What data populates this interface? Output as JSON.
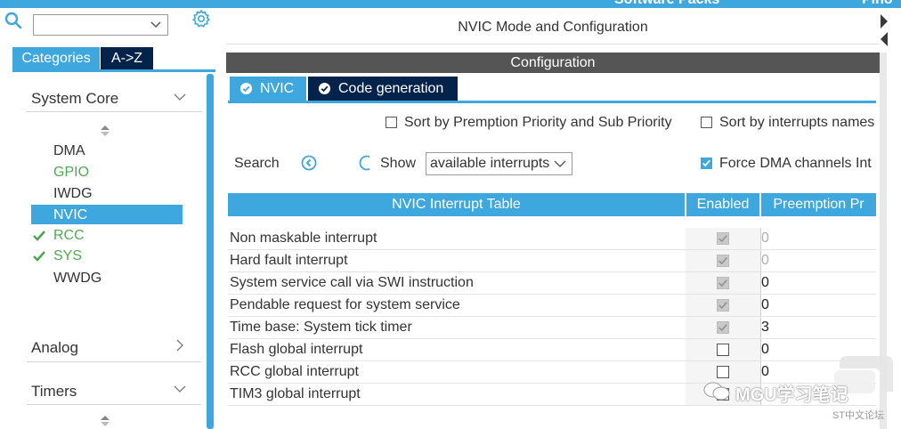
{
  "topbar": {
    "right_text": "Software Packs",
    "far_right": "Pino"
  },
  "left_panel": {
    "search": {
      "value": ""
    },
    "tabs": [
      {
        "label": "Categories"
      },
      {
        "label": "A->Z"
      }
    ],
    "groups": [
      {
        "title": "System Core",
        "expanded": true,
        "items": [
          {
            "label": "DMA",
            "status": "normal"
          },
          {
            "label": "GPIO",
            "status": "configured"
          },
          {
            "label": "IWDG",
            "status": "normal"
          },
          {
            "label": "NVIC",
            "status": "selected"
          },
          {
            "label": "RCC",
            "status": "checked"
          },
          {
            "label": "SYS",
            "status": "checked"
          },
          {
            "label": "WWDG",
            "status": "normal"
          }
        ]
      },
      {
        "title": "Analog",
        "expanded": false
      },
      {
        "title": "Timers",
        "expanded": true
      }
    ]
  },
  "main": {
    "mode_title": "NVIC Mode and Configuration",
    "config_title": "Configuration",
    "tabs": [
      {
        "label": "NVIC"
      },
      {
        "label": "Code generation"
      }
    ],
    "options": {
      "sort_priority": {
        "label": "Sort by Premption Priority and Sub Priority",
        "checked": false
      },
      "sort_names": {
        "label": "Sort by interrupts names",
        "checked": false
      },
      "force_dma": {
        "label": "Force DMA channels Int",
        "checked": true
      }
    },
    "search_label": "Search",
    "show_label": "Show",
    "show_value": "available interrupts",
    "table": {
      "headers": [
        "NVIC Interrupt Table",
        "Enabled",
        "Preemption Pr"
      ],
      "rows": [
        {
          "name": "Non maskable interrupt",
          "enabled": true,
          "locked": true,
          "preemption": "0"
        },
        {
          "name": "Hard fault interrupt",
          "enabled": true,
          "locked": true,
          "preemption": "0"
        },
        {
          "name": "System service call via SWI instruction",
          "enabled": true,
          "locked": true,
          "preemption": "0"
        },
        {
          "name": "Pendable request for system service",
          "enabled": true,
          "locked": true,
          "preemption": "0"
        },
        {
          "name": "Time base: System tick timer",
          "enabled": true,
          "locked": true,
          "preemption": "3"
        },
        {
          "name": "Flash global interrupt",
          "enabled": false,
          "locked": false,
          "preemption": "0"
        },
        {
          "name": "RCC global interrupt",
          "enabled": false,
          "locked": false,
          "preemption": "0"
        },
        {
          "name": "TIM3 global interrupt",
          "enabled": false,
          "locked": false,
          "preemption": ""
        }
      ]
    }
  },
  "watermark": {
    "text": "MGU学习笔记",
    "sub": "ST中文论坛"
  },
  "colors": {
    "accent": "#3ea7dd",
    "dark_tab": "#03234b",
    "config_header": "#555555",
    "green": "#52a852"
  }
}
